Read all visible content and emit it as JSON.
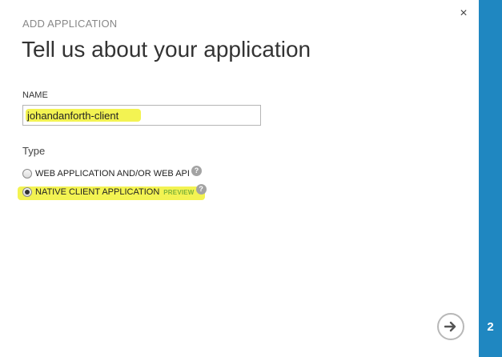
{
  "dialog": {
    "eyebrow": "ADD APPLICATION",
    "title": "Tell us about your application",
    "close_icon": "×",
    "step": "2"
  },
  "name_field": {
    "label": "NAME",
    "value": "johandanforth-client"
  },
  "type_field": {
    "label": "Type",
    "options": [
      {
        "label": "WEB APPLICATION AND/OR WEB API",
        "selected": false,
        "help": "?"
      },
      {
        "label": "NATIVE CLIENT APPLICATION",
        "badge": "PREVIEW",
        "selected": true,
        "help": "?"
      }
    ]
  },
  "navigation": {
    "next_icon": "arrow-right-circle-icon"
  },
  "colors": {
    "accent_panel": "#1f87c1",
    "highlight": "#f3f352",
    "preview_badge": "#7fb33a"
  }
}
